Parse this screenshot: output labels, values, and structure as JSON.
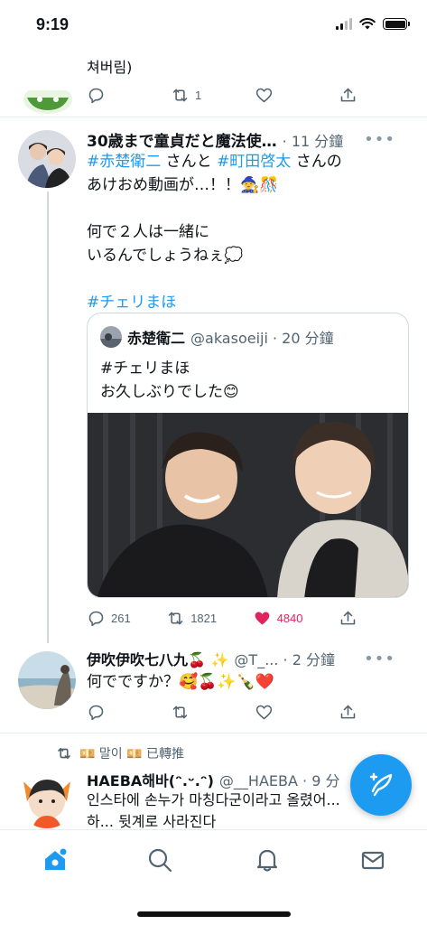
{
  "status_bar": {
    "time": "9:19"
  },
  "previous_tweet": {
    "text_tail": "쳐버림)",
    "reply_count": "",
    "retweet_count": "1",
    "like_count": ""
  },
  "main_tweet": {
    "display_name": "30歳まで童貞だと魔法使…",
    "time": "· 11 分鐘",
    "line1_tag1": "#赤楚衛二",
    "line1_mid": " さんと ",
    "line1_tag2": "#町田啓太",
    "line1_end": " さんの",
    "line2": "あけおめ動画が…！！🧙🎊",
    "line3": "何で２人は一緒に",
    "line4": "いるんでしょうねぇ💭",
    "hashtag_line": "#チェリまほ",
    "reply_count": "261",
    "retweet_count": "1821",
    "like_count": "4840",
    "like_color": "#e0245e"
  },
  "quoted_tweet": {
    "display_name": "赤楚衛二",
    "handle_time": "@akasoeiji · 20 分鐘",
    "line1": "#チェリまほ",
    "line2": "お久しぶりでした😊"
  },
  "reply_tweet": {
    "display_name": "伊吹伊吹七八九🍒 ✨",
    "handle_time": "@T_... · 2 分鐘",
    "text": "何でですか？🥰🍒✨🍾❤️",
    "reply_count": "",
    "retweet_count": "",
    "like_count": ""
  },
  "next_tweet": {
    "retweet_context": "💴 말이 💴 已轉推",
    "display_name": "HAEBA해바(ᵔ.ᵕ.ᵔ)",
    "handle_time": "@__HAEBA · 9 分",
    "line1": "인스타에 손누가 마칭다군이라고 올렸어...",
    "line2": "하... 뒷계로 사라진다"
  },
  "colors": {
    "accent": "#1d9bf0",
    "secondary_text": "#536471",
    "divider": "#e6ecf0"
  },
  "tab_bar": {
    "icons": [
      "home-icon",
      "search-icon",
      "notifications-icon",
      "messages-icon"
    ]
  },
  "fab_icon": "compose-tweet-icon"
}
